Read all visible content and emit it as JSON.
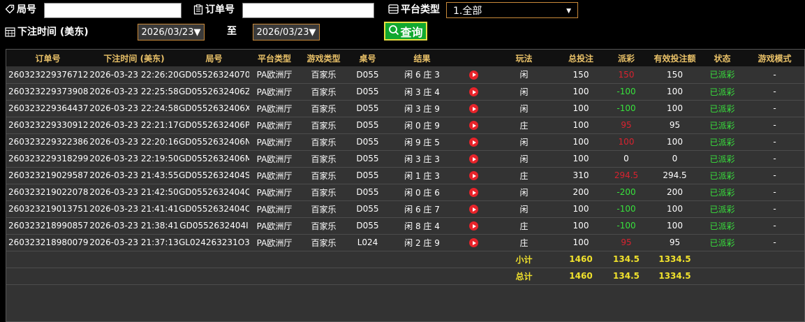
{
  "filters": {
    "bureau_label": "局号",
    "bureau_value": "",
    "order_label": "订单号",
    "order_value": "",
    "platform_label": "平台类型",
    "platform_selected": "1.全部",
    "time_label": "下注时间 (美东)",
    "date_from": "2026/03/23▼",
    "to_label": "至",
    "date_to": "2026/03/23▼",
    "query_label": "查询"
  },
  "table": {
    "columns": [
      "订单号",
      "下注时间 (美东)",
      "局号",
      "平台类型",
      "游戏类型",
      "桌号",
      "结果",
      "",
      "玩法",
      "总投注",
      "派彩",
      "有效投注额",
      "状态",
      "游戏模式"
    ],
    "rows": [
      {
        "id": "260323229376712",
        "time": "2026-03-23 22:26:20",
        "round": "GD05526324070",
        "platform": "PA欧洲厅",
        "game": "百家乐",
        "table": "D055",
        "result": "闲 6 庄 3",
        "play": "闲",
        "bet": "150",
        "payout": "150",
        "payout_type": "pos",
        "valid": "150",
        "status": "已派彩",
        "mode": "-"
      },
      {
        "id": "260323229373908",
        "time": "2026-03-23 22:25:58",
        "round": "GD0552632406Z",
        "platform": "PA欧洲厅",
        "game": "百家乐",
        "table": "D055",
        "result": "闲 3 庄 4",
        "play": "闲",
        "bet": "100",
        "payout": "-100",
        "payout_type": "neg",
        "valid": "100",
        "status": "已派彩",
        "mode": "-"
      },
      {
        "id": "260323229364437",
        "time": "2026-03-23 22:24:58",
        "round": "GD0552632406X",
        "platform": "PA欧洲厅",
        "game": "百家乐",
        "table": "D055",
        "result": "闲 3 庄 9",
        "play": "闲",
        "bet": "100",
        "payout": "-100",
        "payout_type": "neg",
        "valid": "100",
        "status": "已派彩",
        "mode": "-"
      },
      {
        "id": "260323229330912",
        "time": "2026-03-23 22:21:17",
        "round": "GD0552632406P",
        "platform": "PA欧洲厅",
        "game": "百家乐",
        "table": "D055",
        "result": "闲 0 庄 9",
        "play": "庄",
        "bet": "100",
        "payout": "95",
        "payout_type": "pos",
        "valid": "95",
        "status": "已派彩",
        "mode": "-"
      },
      {
        "id": "260323229322386",
        "time": "2026-03-23 22:20:16",
        "round": "GD0552632406N",
        "platform": "PA欧洲厅",
        "game": "百家乐",
        "table": "D055",
        "result": "闲 9 庄 5",
        "play": "闲",
        "bet": "100",
        "payout": "100",
        "payout_type": "pos",
        "valid": "100",
        "status": "已派彩",
        "mode": "-"
      },
      {
        "id": "260323229318299",
        "time": "2026-03-23 22:19:50",
        "round": "GD0552632406M",
        "platform": "PA欧洲厅",
        "game": "百家乐",
        "table": "D055",
        "result": "闲 3 庄 3",
        "play": "闲",
        "bet": "100",
        "payout": "0",
        "payout_type": "zero",
        "valid": "0",
        "status": "已派彩",
        "mode": "-"
      },
      {
        "id": "260323219029587",
        "time": "2026-03-23 21:43:55",
        "round": "GD0552632404S",
        "platform": "PA欧洲厅",
        "game": "百家乐",
        "table": "D055",
        "result": "闲 1 庄 3",
        "play": "庄",
        "bet": "310",
        "payout": "294.5",
        "payout_type": "pos",
        "valid": "294.5",
        "status": "已派彩",
        "mode": "-"
      },
      {
        "id": "260323219022078",
        "time": "2026-03-23 21:42:50",
        "round": "GD0552632404Q",
        "platform": "PA欧洲厅",
        "game": "百家乐",
        "table": "D055",
        "result": "闲 0 庄 6",
        "play": "闲",
        "bet": "200",
        "payout": "-200",
        "payout_type": "neg",
        "valid": "200",
        "status": "已派彩",
        "mode": "-"
      },
      {
        "id": "260323219013751",
        "time": "2026-03-23 21:41:41",
        "round": "GD0552632404O",
        "platform": "PA欧洲厅",
        "game": "百家乐",
        "table": "D055",
        "result": "闲 6 庄 7",
        "play": "闲",
        "bet": "100",
        "payout": "-100",
        "payout_type": "neg",
        "valid": "100",
        "status": "已派彩",
        "mode": "-"
      },
      {
        "id": "260323218990857",
        "time": "2026-03-23 21:38:41",
        "round": "GD0552632404I",
        "platform": "PA欧洲厅",
        "game": "百家乐",
        "table": "D055",
        "result": "闲 8 庄 4",
        "play": "庄",
        "bet": "100",
        "payout": "-100",
        "payout_type": "neg",
        "valid": "100",
        "status": "已派彩",
        "mode": "-"
      },
      {
        "id": "260323218980079",
        "time": "2026-03-23 21:37:13",
        "round": "GL024263231O3",
        "platform": "PA欧洲厅",
        "game": "百家乐",
        "table": "L024",
        "result": "闲 2 庄 9",
        "play": "庄",
        "bet": "100",
        "payout": "95",
        "payout_type": "pos",
        "valid": "95",
        "status": "已派彩",
        "mode": "-"
      }
    ],
    "subtotal": {
      "label": "小计",
      "bet": "1460",
      "payout": "134.5",
      "valid": "1334.5"
    },
    "total": {
      "label": "总计",
      "bet": "1460",
      "payout": "134.5",
      "valid": "1334.5"
    }
  },
  "colors": {
    "accent_orange": "#c98a3a",
    "header_gold": "#e9c168",
    "loss_green": "#38e13c",
    "win_red": "#d9222f",
    "sum_yellow": "#f0e12c",
    "query_green": "#11a82f"
  }
}
